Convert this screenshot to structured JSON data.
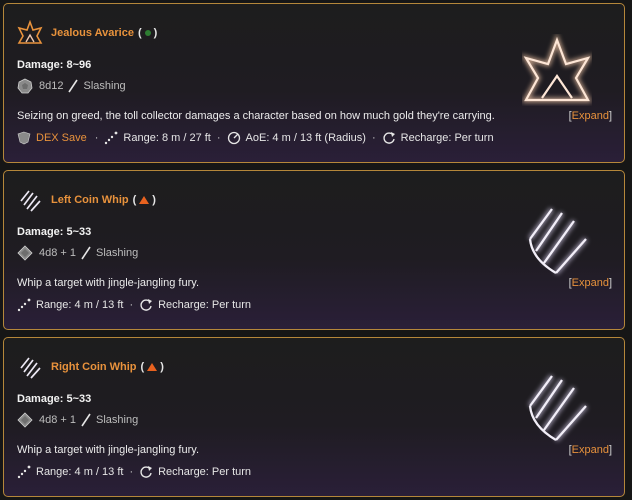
{
  "cards": [
    {
      "title": "Jealous Avarice",
      "paren_open": "(",
      "paren_close": ")",
      "status_icon": "green-dot",
      "damage": "Damage: 8~96",
      "dice": "8d12",
      "damage_type": "Slashing",
      "description": "Seizing on greed, the toll collector damages a character based on how much gold they're carrying.",
      "expand_label": "Expand",
      "save_label": "DEX Save",
      "range": "Range: 8 m / 27 ft",
      "aoe": "AoE: 4 m / 13 ft (Radius)",
      "recharge": "Recharge: Per turn",
      "icon": "crown-flame-icon"
    },
    {
      "title": "Left Coin Whip",
      "paren_open": "(",
      "paren_close": ")",
      "status_icon": "orange-triangle",
      "damage": "Damage: 5~33",
      "dice": "4d8 + 1",
      "damage_type": "Slashing",
      "description": "Whip a target with jingle-jangling fury.",
      "expand_label": "Expand",
      "range": "Range: 4 m / 13 ft",
      "recharge": "Recharge: Per turn",
      "icon": "claw-slash-icon"
    },
    {
      "title": "Right Coin Whip",
      "paren_open": "(",
      "paren_close": ")",
      "status_icon": "orange-triangle",
      "damage": "Damage: 5~33",
      "dice": "4d8 + 1",
      "damage_type": "Slashing",
      "description": "Whip a target with jingle-jangling fury.",
      "expand_label": "Expand",
      "range": "Range: 4 m / 13 ft",
      "recharge": "Recharge: Per turn",
      "icon": "claw-slash-icon"
    }
  ],
  "colors": {
    "accent": "#e8923c",
    "border": "#b5873a",
    "green": "#2e7d32",
    "triangle": "#e8621f"
  }
}
